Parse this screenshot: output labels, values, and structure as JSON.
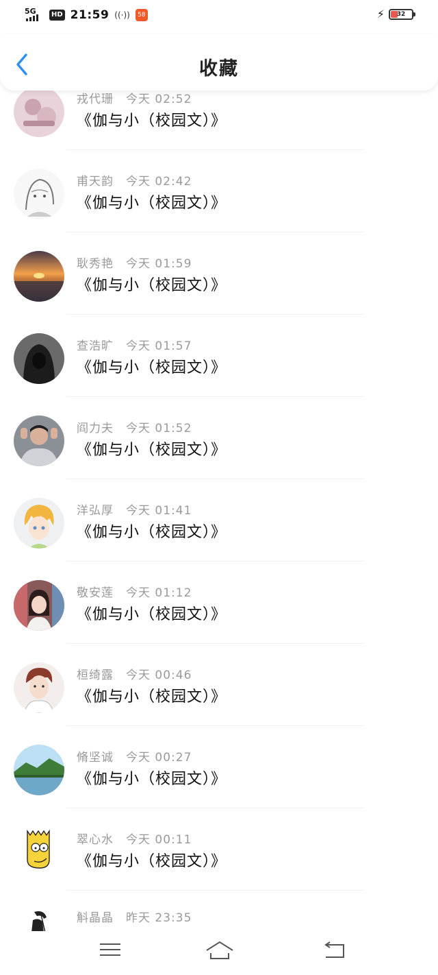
{
  "status_bar": {
    "network": "5G",
    "hd": "HD",
    "time": "21:59",
    "wifi": "((·))",
    "app_badge": "58",
    "battery_level": "32"
  },
  "header": {
    "title": "收藏"
  },
  "items": [
    {
      "name": "戎代珊",
      "time": "今天 02:52",
      "book": "《伽与小（校园文）》",
      "avatar": "avatar-pink"
    },
    {
      "name": "甫天韵",
      "time": "今天 02:42",
      "book": "《伽与小（校园文）》",
      "avatar": "avatar-sketch-girl"
    },
    {
      "name": "耿秀艳",
      "time": "今天 01:59",
      "book": "《伽与小（校园文）》",
      "avatar": "avatar-sunset"
    },
    {
      "name": "查浩旷",
      "time": "今天 01:57",
      "book": "《伽与小（校园文）》",
      "avatar": "avatar-hood"
    },
    {
      "name": "阎力夫",
      "time": "今天 01:52",
      "book": "《伽与小（校园文）》",
      "avatar": "avatar-boy"
    },
    {
      "name": "洋弘厚",
      "time": "今天 01:41",
      "book": "《伽与小（校园文）》",
      "avatar": "avatar-anime"
    },
    {
      "name": "敬安莲",
      "time": "今天 01:12",
      "book": "《伽与小（校园文）》",
      "avatar": "avatar-girl"
    },
    {
      "name": "桓绮露",
      "time": "今天 00:46",
      "book": "《伽与小（校园文）》",
      "avatar": "avatar-drawing-boy"
    },
    {
      "name": "脩坚诚",
      "time": "今天 00:27",
      "book": "《伽与小（校园文）》",
      "avatar": "avatar-landscape"
    },
    {
      "name": "翠心水",
      "time": "今天 00:11",
      "book": "《伽与小（校园文）》",
      "avatar": "avatar-cartoon"
    },
    {
      "name": "斛晶晶",
      "time": "昨天 23:35",
      "book": "",
      "avatar": "avatar-reaper"
    }
  ],
  "colors": {
    "accent": "#2d8ff0",
    "meta_text": "#9a9a9a",
    "divider": "#f0f0f0"
  },
  "icons": {
    "back": "chevron-left-icon",
    "menu": "menu-icon",
    "home": "home-icon",
    "back_nav": "return-icon"
  }
}
